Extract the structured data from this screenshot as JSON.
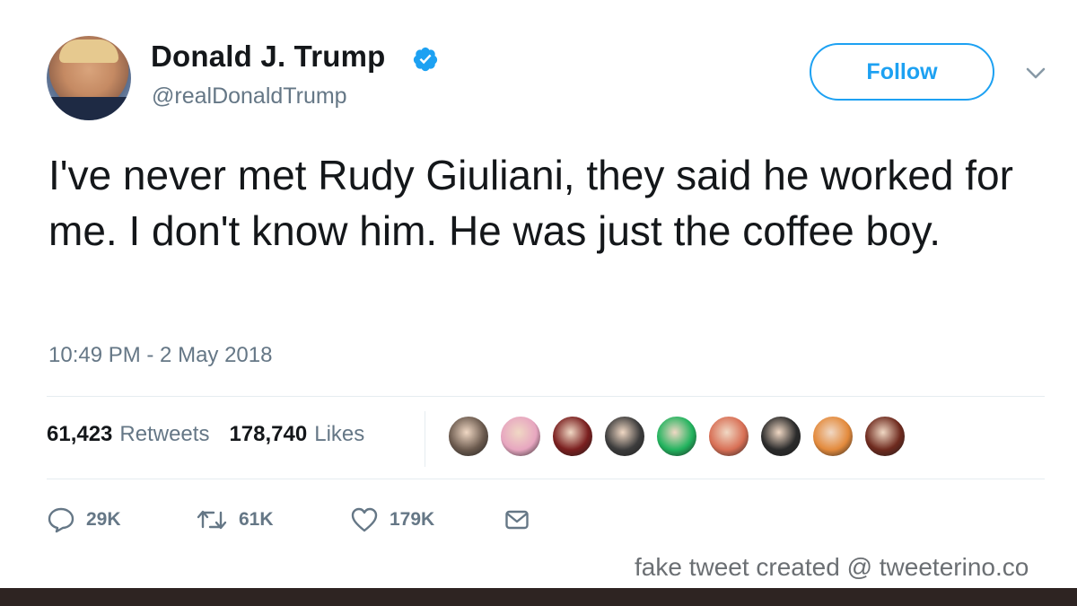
{
  "author": {
    "display_name": "Donald J. Trump",
    "handle": "@realDonaldTrump",
    "verified": true,
    "avatar_icon": "profile-photo"
  },
  "header": {
    "follow_label": "Follow",
    "menu_icon": "chevron-down-icon"
  },
  "tweet": {
    "text": "I've never met Rudy Giuliani, they said he worked for me. I don't know him. He was just the coffee boy.",
    "timestamp": "10:49 PM - 2 May 2018"
  },
  "stats": {
    "retweets_count": "61,423",
    "retweets_label": "Retweets",
    "likes_count": "178,740",
    "likes_label": "Likes"
  },
  "likers": [
    {
      "icon": "liker-avatar-1",
      "color": "#6b5a4e"
    },
    {
      "icon": "liker-avatar-2",
      "color": "#e7a6c0"
    },
    {
      "icon": "liker-avatar-3",
      "color": "#7a1f1f"
    },
    {
      "icon": "liker-avatar-4",
      "color": "#3c3c3c"
    },
    {
      "icon": "liker-avatar-5",
      "color": "#22b35e"
    },
    {
      "icon": "liker-avatar-6",
      "color": "#d86f55"
    },
    {
      "icon": "liker-avatar-7",
      "color": "#2b2b2b"
    },
    {
      "icon": "liker-avatar-8",
      "color": "#e38a3c"
    },
    {
      "icon": "liker-avatar-9",
      "color": "#6e2a1e"
    }
  ],
  "actions": {
    "reply_count": "29K",
    "retweet_count": "61K",
    "like_count": "179K",
    "icons": [
      "reply-icon",
      "retweet-icon",
      "like-icon",
      "message-icon"
    ]
  },
  "watermark": "fake tweet created @ tweeterino.co",
  "colors": {
    "accent": "#1da1f2",
    "secondary_text": "#657786",
    "bottom_bar": "#2e2422"
  }
}
